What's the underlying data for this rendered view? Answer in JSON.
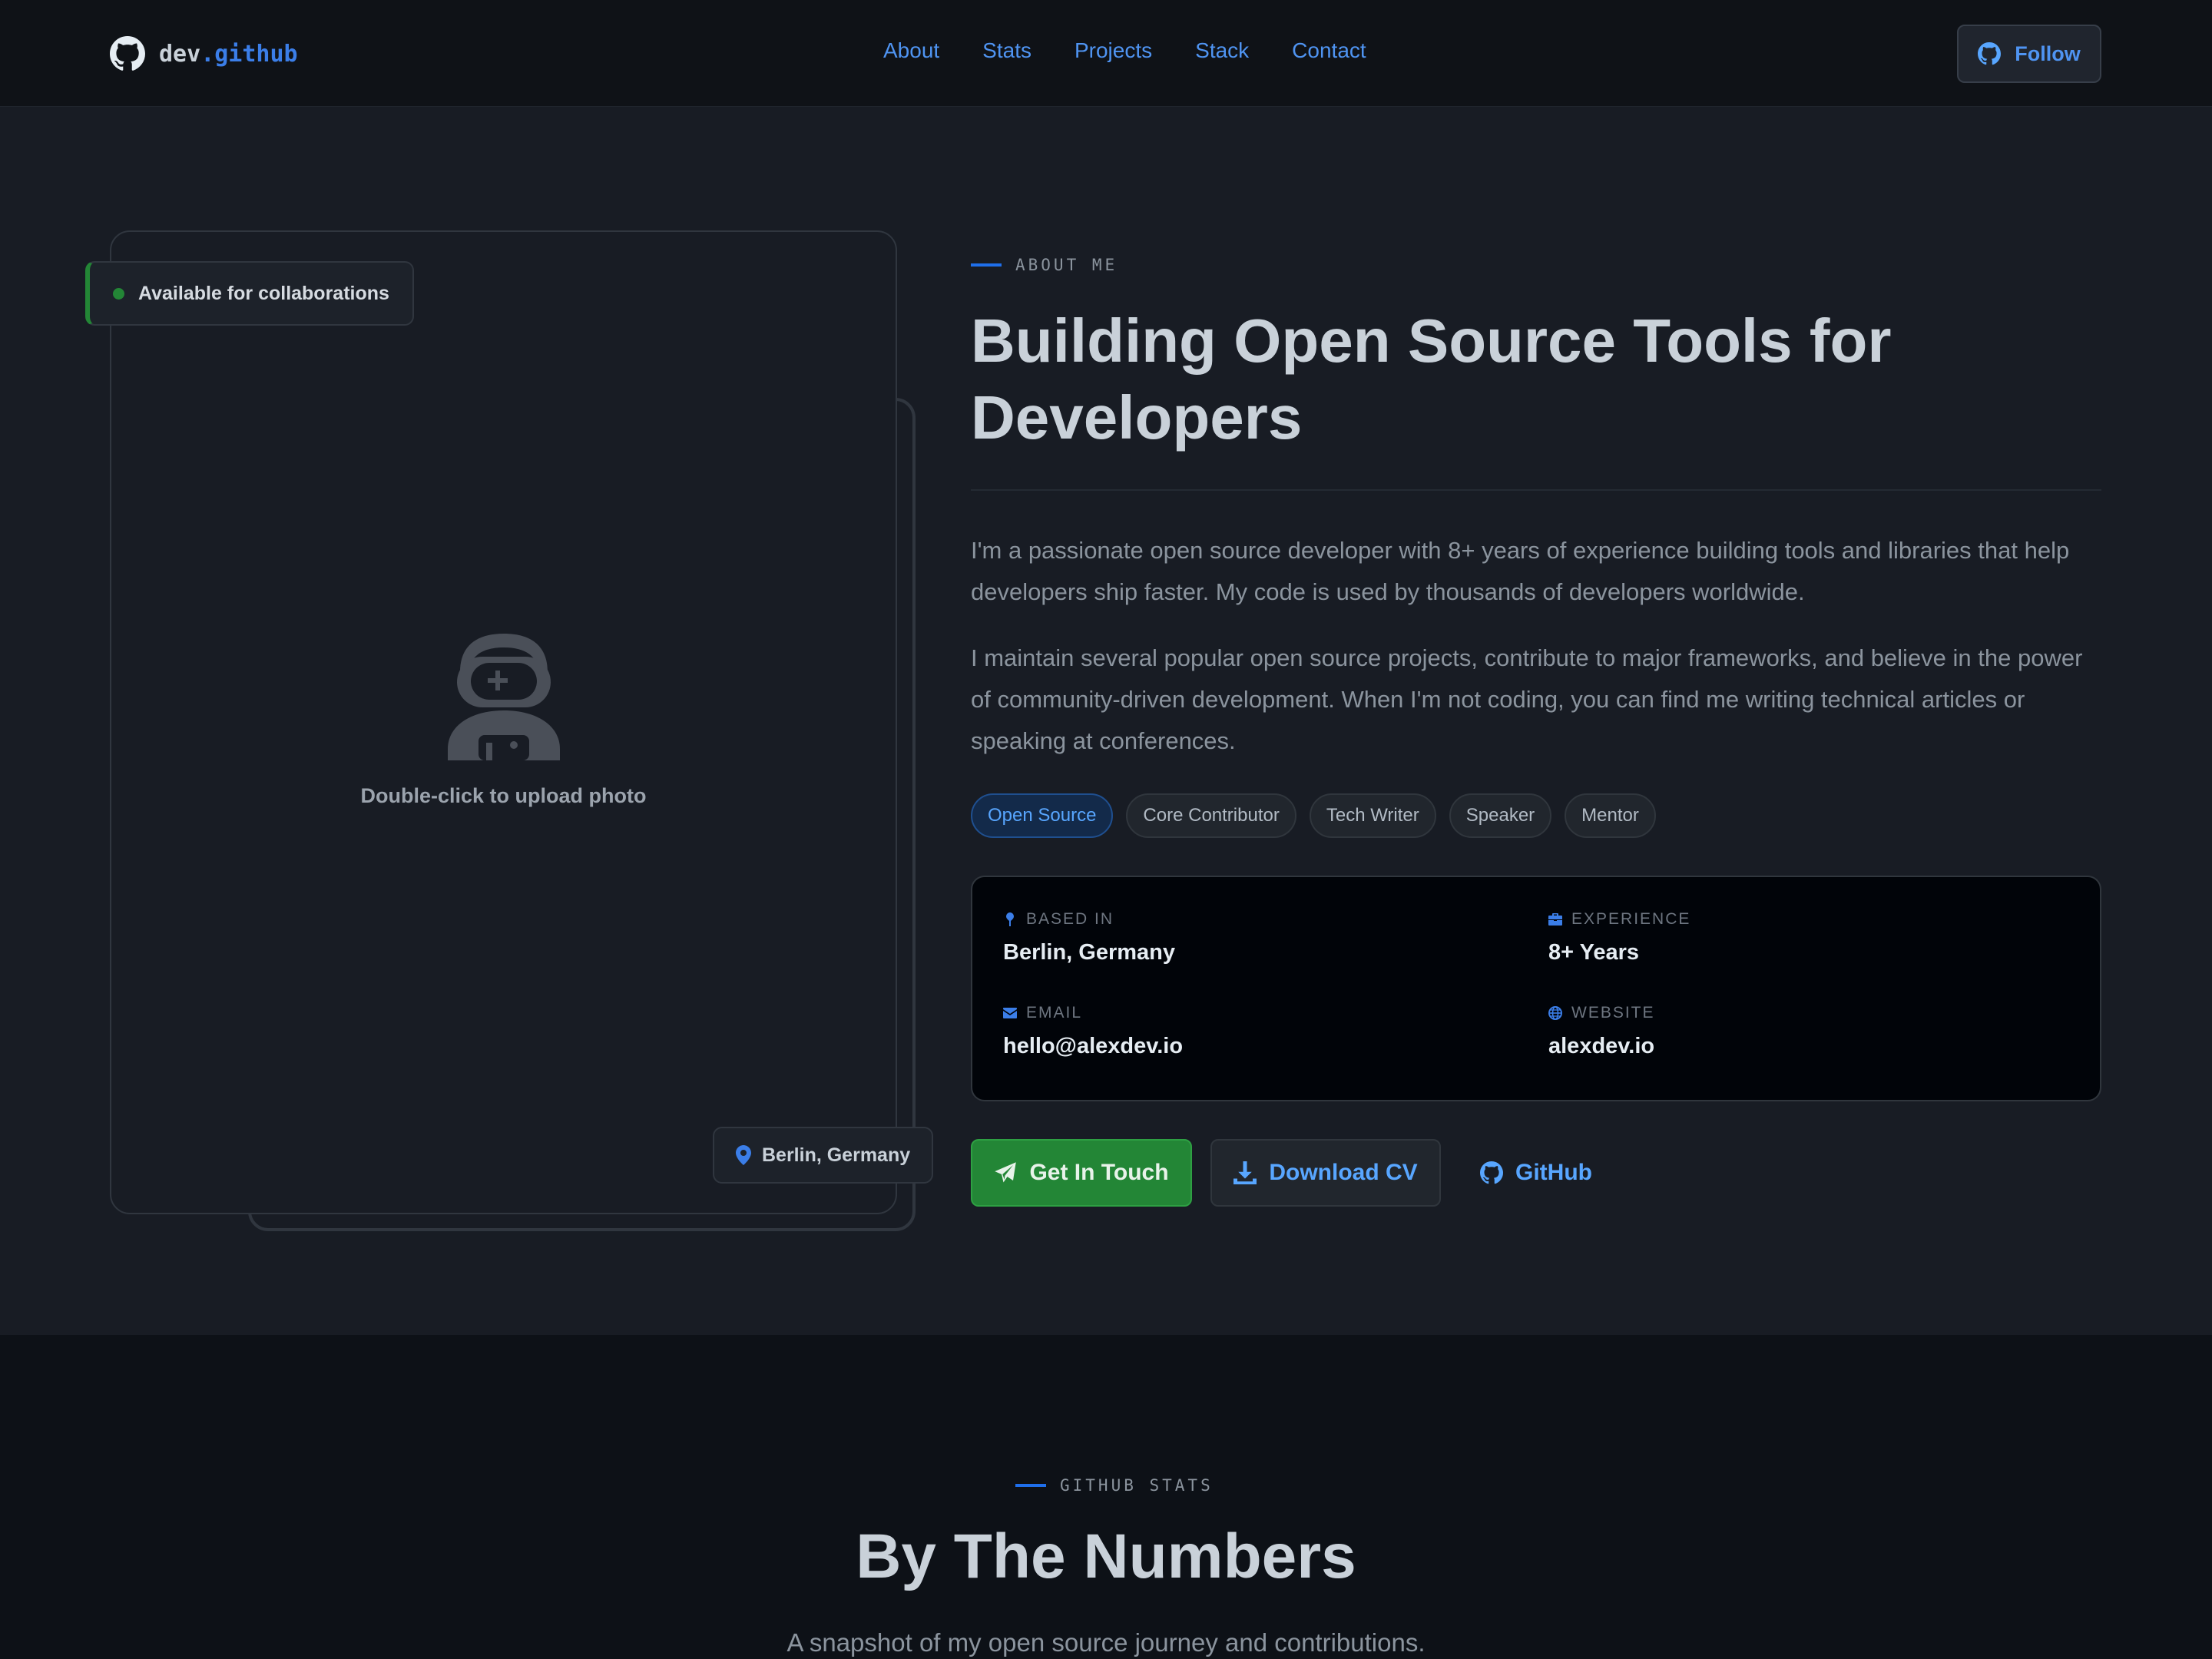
{
  "nav": {
    "brand_prefix": "dev",
    "brand_dot": ".",
    "brand_suffix": "github",
    "links": [
      "About",
      "Stats",
      "Projects",
      "Stack",
      "Contact"
    ],
    "follow_label": "Follow"
  },
  "photo": {
    "availability": "Available for collaborations",
    "upload_hint": "Double-click to upload photo",
    "location_badge": "Berlin, Germany"
  },
  "about": {
    "eyebrow": "ABOUT ME",
    "headline_line1": "Building Open Source Tools for",
    "headline_line2": "Developers",
    "paragraph1": "I'm a passionate open source developer with 8+ years of experience building tools and libraries that help developers ship faster. My code is used by thousands of developers worldwide.",
    "paragraph2": "I maintain several popular open source projects, contribute to major frameworks, and believe in the power of community-driven development. When I'm not coding, you can find me writing technical articles or speaking at conferences.",
    "tags": [
      "Open Source",
      "Core Contributor",
      "Tech Writer",
      "Speaker",
      "Mentor"
    ]
  },
  "info": {
    "based_label": "BASED IN",
    "based_value": "Berlin, Germany",
    "experience_label": "EXPERIENCE",
    "experience_value": "8+ Years",
    "email_label": "EMAIL",
    "email_value": "hello@alexdev.io",
    "website_label": "WEBSITE",
    "website_value": "alexdev.io"
  },
  "actions": {
    "contact_label": "Get In Touch",
    "cv_label": "Download CV",
    "github_label": "GitHub"
  },
  "stats": {
    "eyebrow": "GITHUB STATS",
    "title": "By The Numbers",
    "subtitle": "A snapshot of my open source journey and contributions."
  },
  "colors": {
    "accent": "#1f6feb",
    "link": "#58a6ff",
    "success": "#238636",
    "background": "#181c24",
    "nav_background": "#0f1217"
  },
  "icons": {
    "brand": "github-icon",
    "follow": "github-icon",
    "avatar": "astronaut-icon",
    "location": "map-pin-icon",
    "experience": "briefcase-icon",
    "email": "envelope-icon",
    "website": "globe-icon",
    "contact": "paper-plane-icon",
    "cv": "download-icon",
    "github_link": "github-icon"
  }
}
